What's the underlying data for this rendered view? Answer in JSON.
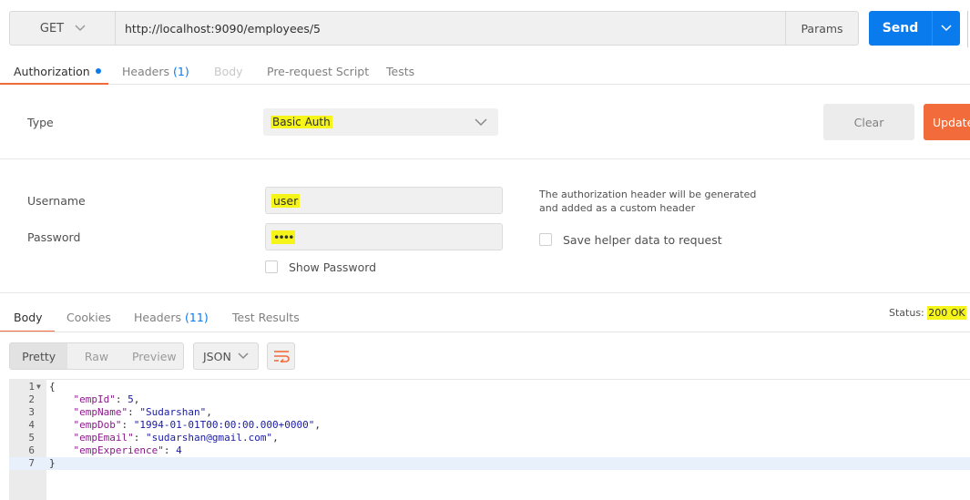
{
  "request": {
    "method": "GET",
    "url": "http://localhost:9090/employees/5",
    "params_label": "Params",
    "send_label": "Send"
  },
  "request_tabs": [
    {
      "label": "Authorization",
      "count": "",
      "state": "active"
    },
    {
      "label": "Headers",
      "count": "(1)",
      "state": "normal"
    },
    {
      "label": "Body",
      "count": "",
      "state": "disabled"
    },
    {
      "label": "Pre-request Script",
      "count": "",
      "state": "normal"
    },
    {
      "label": "Tests",
      "count": "",
      "state": "normal"
    }
  ],
  "auth": {
    "type_label": "Type",
    "type_value": "Basic Auth",
    "clear_label": "Clear",
    "update_label": "Update Request",
    "username_label": "Username",
    "username_value": "user",
    "password_label": "Password",
    "password_value": "••••",
    "show_password_label": "Show Password",
    "help_text": "The authorization header will be generated and added as a custom header",
    "save_helper_label": "Save helper data to request"
  },
  "response_tabs": [
    {
      "label": "Body",
      "count": "",
      "state": "active"
    },
    {
      "label": "Cookies",
      "count": "",
      "state": "normal"
    },
    {
      "label": "Headers",
      "count": "(11)",
      "state": "normal"
    },
    {
      "label": "Test Results",
      "count": "",
      "state": "normal"
    }
  ],
  "status": {
    "label": "Status:",
    "value": "200 OK"
  },
  "response_view": {
    "modes": [
      "Pretty",
      "Raw",
      "Preview"
    ],
    "active_mode": "Pretty",
    "format": "JSON"
  },
  "code_lines": [
    {
      "n": "1",
      "text": "{"
    },
    {
      "n": "2",
      "key": "\"empId\"",
      "val": "5",
      "vtype": "num",
      "trail": ","
    },
    {
      "n": "3",
      "key": "\"empName\"",
      "val": "\"Sudarshan\"",
      "vtype": "str",
      "trail": ","
    },
    {
      "n": "4",
      "key": "\"empDob\"",
      "val": "\"1994-01-01T00:00:00.000+0000\"",
      "vtype": "str",
      "trail": ","
    },
    {
      "n": "5",
      "key": "\"empEmail\"",
      "val": "\"sudarshan@gmail.com\"",
      "vtype": "str",
      "trail": ","
    },
    {
      "n": "6",
      "key": "\"empExperience\"",
      "val": "4",
      "vtype": "num",
      "trail": ""
    },
    {
      "n": "7",
      "text": "}"
    }
  ],
  "colors": {
    "accent_blue": "#097bed",
    "accent_orange": "#f26b3a",
    "highlight": "#f5f51a"
  },
  "icons": [
    "chevron-down-icon",
    "wrap-lines-icon",
    "fold-arrow-icon"
  ]
}
